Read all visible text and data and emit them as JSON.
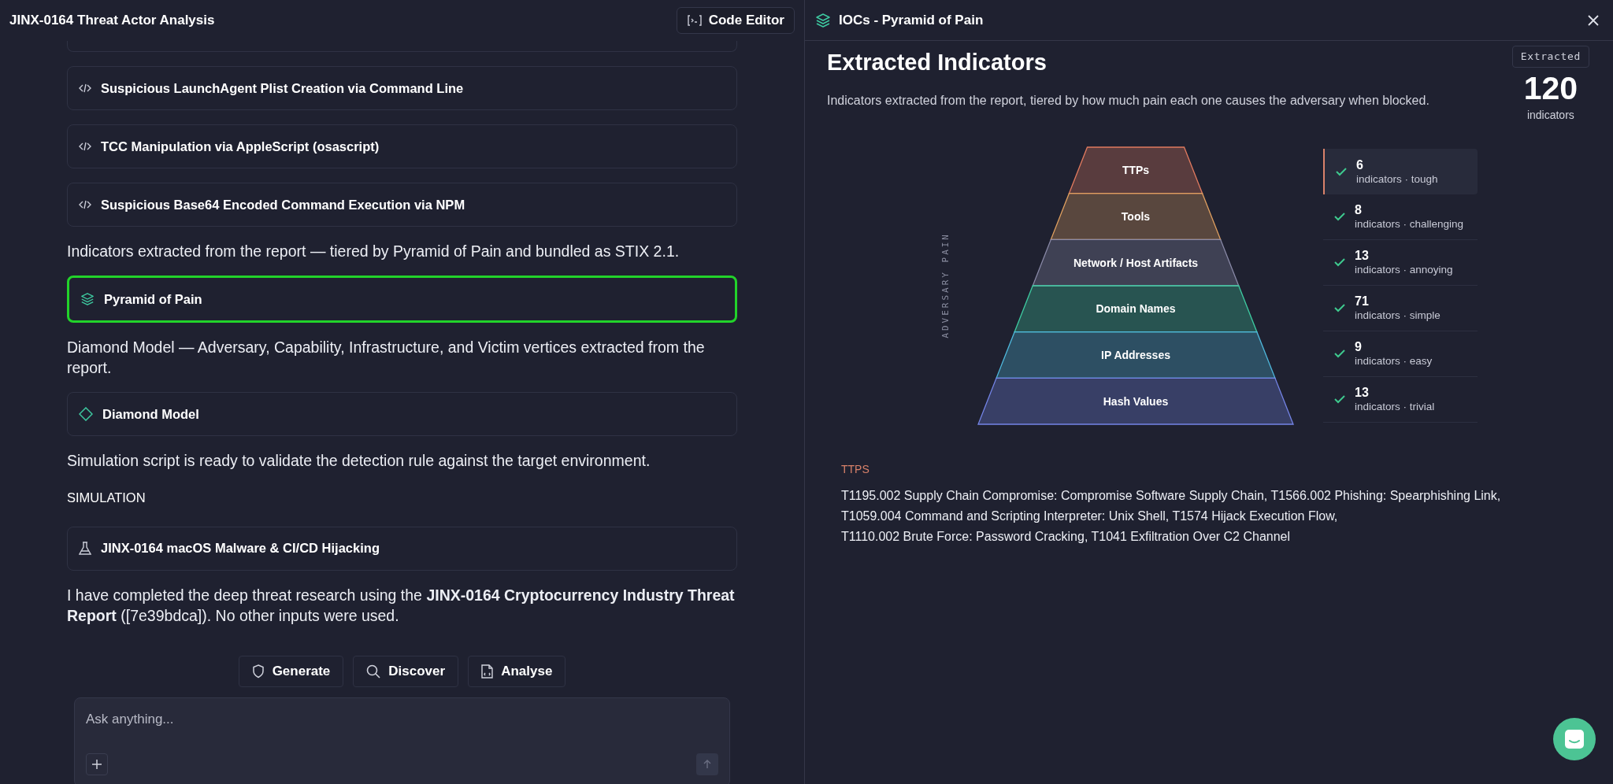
{
  "left_panel": {
    "title": "JINX-0164 Threat Actor Analysis",
    "code_editor_button": "Code Editor",
    "messages": [
      {
        "kind": "rule_card",
        "label": "Suspicious LaunchAgent Plist Creation via Command Line",
        "selected": false
      },
      {
        "kind": "rule_card",
        "label": "TCC Manipulation via AppleScript (osascript)",
        "selected": false
      },
      {
        "kind": "rule_card",
        "label": "Suspicious Base64 Encoded Command Execution via NPM",
        "selected": false
      },
      {
        "kind": "paragraph",
        "text": "Indicators extracted from the report — tiered by Pyramid of Pain and bundled as STIX 2.1."
      },
      {
        "kind": "pyramid_card",
        "label": "Pyramid of Pain",
        "selected": true
      },
      {
        "kind": "paragraph",
        "text": "Diamond Model — Adversary, Capability, Infrastructure, and Victim vertices extracted from the report."
      },
      {
        "kind": "diamond_card",
        "label": "Diamond Model",
        "selected": false
      },
      {
        "kind": "paragraph",
        "text": "Simulation script is ready to validate the detection rule against the target environment."
      },
      {
        "kind": "heading",
        "text": "SIMULATION"
      },
      {
        "kind": "simulation_card",
        "label": "JINX-0164 macOS Malware & CI/CD Hijacking",
        "selected": false
      },
      {
        "kind": "paragraph",
        "text": "I have completed the deep threat research using the **JINX-0164 Cryptocurrency Industry Threat Report** ([7e39bdca]). No other inputs were used."
      }
    ],
    "actions": [
      {
        "label": "Generate"
      },
      {
        "label": "Discover"
      },
      {
        "label": "Analyse"
      }
    ],
    "chat_input": {
      "placeholder": "Ask anything..."
    }
  },
  "right_panel": {
    "title": "IOCs - Pyramid of Pain",
    "heading": "Extracted Indicators",
    "description": "Indicators extracted from the report, tiered by how much pain each one causes the adversary when blocked.",
    "summary": {
      "badge": "Extracted",
      "count": "120",
      "unit": "indicators"
    },
    "axis_label": "ADVERSARY PAIN",
    "tiers": [
      {
        "label": "TTPs",
        "color": "#e07a5f",
        "count": "6",
        "caption": "indicators · tough",
        "checked": true,
        "selected": true
      },
      {
        "label": "Tools",
        "color": "#e0a060",
        "count": "8",
        "caption": "indicators · challenging",
        "checked": true,
        "selected": false
      },
      {
        "label": "Network / Host Artifacts",
        "color": "#8a8aa8",
        "count": "13",
        "caption": "indicators · annoying",
        "checked": true,
        "selected": false
      },
      {
        "label": "Domain Names",
        "color": "#3ec9a0",
        "count": "71",
        "caption": "indicators · simple",
        "checked": true,
        "selected": false
      },
      {
        "label": "IP Addresses",
        "color": "#4fb8dc",
        "count": "9",
        "caption": "indicators · easy",
        "checked": true,
        "selected": false
      },
      {
        "label": "Hash Values",
        "color": "#7484e6",
        "count": "13",
        "caption": "indicators · trivial",
        "checked": true,
        "selected": false
      }
    ],
    "ttps": {
      "label": "TTPS",
      "lines": [
        "T1195.002 Supply Chain Compromise: Compromise Software Supply Chain, T1566.002 Phishing: Spearphishing Link,",
        "T1059.004 Command and Scripting Interpreter: Unix Shell, T1574 Hijack Execution Flow,",
        "T1110.002 Brute Force: Password Cracking, T1041 Exfiltration Over C2 Channel"
      ]
    }
  }
}
